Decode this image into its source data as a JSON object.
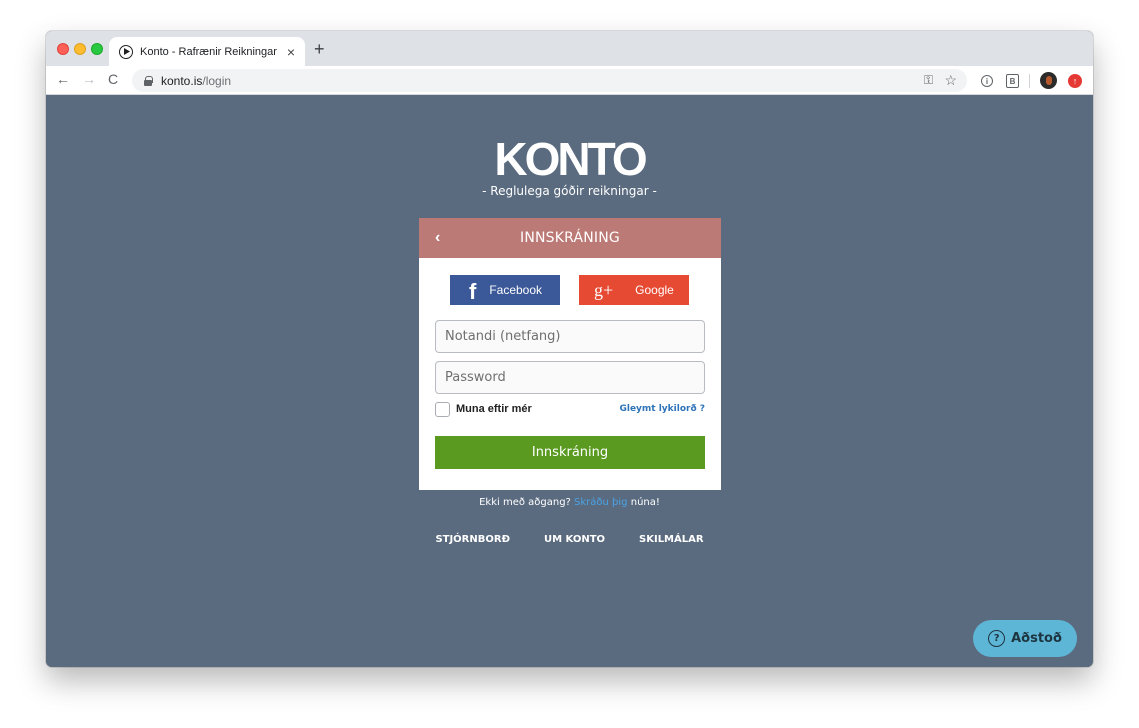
{
  "browser": {
    "tab_title": "Konto - Rafrænir Reikningar",
    "tab_close": "×",
    "new_tab": "+",
    "nav_back": "←",
    "nav_forward": "→",
    "nav_reload": "C",
    "url_host": "konto.is",
    "url_path": "/login",
    "key_icon": "⚿",
    "star_icon": "☆",
    "ext_info_icon": "i",
    "ext_book_icon": "B",
    "update_icon": "↑"
  },
  "brand": {
    "logo": "KONTO",
    "slogan": "- Reglulega góðir reikningar -"
  },
  "login": {
    "back": "‹",
    "title": "INNSKRÁNING",
    "facebook_label": "Facebook",
    "facebook_icon": "f",
    "google_label": "Google",
    "google_icon": "g+",
    "username_placeholder": "Notandi (netfang)",
    "password_placeholder": "Password",
    "remember_label": "Muna eftir mér",
    "forgot_label": "Gleymt lykilorð ?",
    "submit_label": "Innskráning"
  },
  "register": {
    "prefix": "Ekki með aðgang?",
    "link": "Skráðu þig",
    "suffix": "núna!"
  },
  "footer": {
    "links": [
      "STJÓRNBORÐ",
      "UM KONTO",
      "SKILMÁLAR"
    ]
  },
  "help": {
    "label": "Aðstoð",
    "icon": "?"
  },
  "colors": {
    "page_bg": "#5a6a7f",
    "header_bg": "#bc7a76",
    "facebook": "#3b5998",
    "google": "#e64a32",
    "submit": "#5b9a21",
    "link": "#2f73b8",
    "help": "#5eb6d6"
  }
}
